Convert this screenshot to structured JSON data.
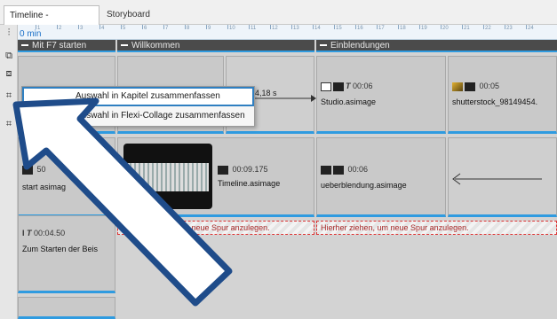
{
  "tabs": [
    {
      "label": "Timeline - Spuransicht"
    },
    {
      "label": "Storyboard"
    }
  ],
  "ruler": {
    "unit_label": "0 min",
    "ticks": [
      "1",
      "2",
      "3",
      "4",
      "5",
      "6",
      "7",
      "8",
      "9",
      "10",
      "11",
      "12",
      "13",
      "14",
      "15",
      "16",
      "17",
      "18",
      "19",
      "20",
      "21",
      "22",
      "23",
      "24"
    ]
  },
  "chapters": {
    "c1": "Mit F7 starten",
    "c2": "Willkommen",
    "c3": "Einblendungen"
  },
  "clips": {
    "transition_duration": "4,18 s",
    "studio": {
      "time": "00:06",
      "name": "Studio.asimage"
    },
    "shutterstock": {
      "time": "00:05",
      "name": "shutterstock_98149454."
    },
    "left_mid": {
      "time": "50",
      "name": "start asimag"
    },
    "timeline_clip": {
      "time": "00:09.175",
      "name": "Timeline.asimage"
    },
    "ueber": {
      "time": "00:06",
      "name": "ueberblendung.asimage"
    },
    "bottom_left": {
      "time": "00:04.50",
      "name": "Zum Starten der Beis"
    }
  },
  "dropzones": {
    "z1": "Hierher ziehen, um neue Spur anzulegen.",
    "z2": "Hierher ziehen, um neue Spur anzulegen."
  },
  "context_menu": {
    "item1": "Auswahl in Kapitel zusammenfassen",
    "item2": "Auswahl in Flexi-Collage zusammenfassen"
  },
  "colors": {
    "accent": "#2f9be0",
    "menu_highlight": "#2f7fc1",
    "arrow_outline": "#1f4c8a"
  }
}
